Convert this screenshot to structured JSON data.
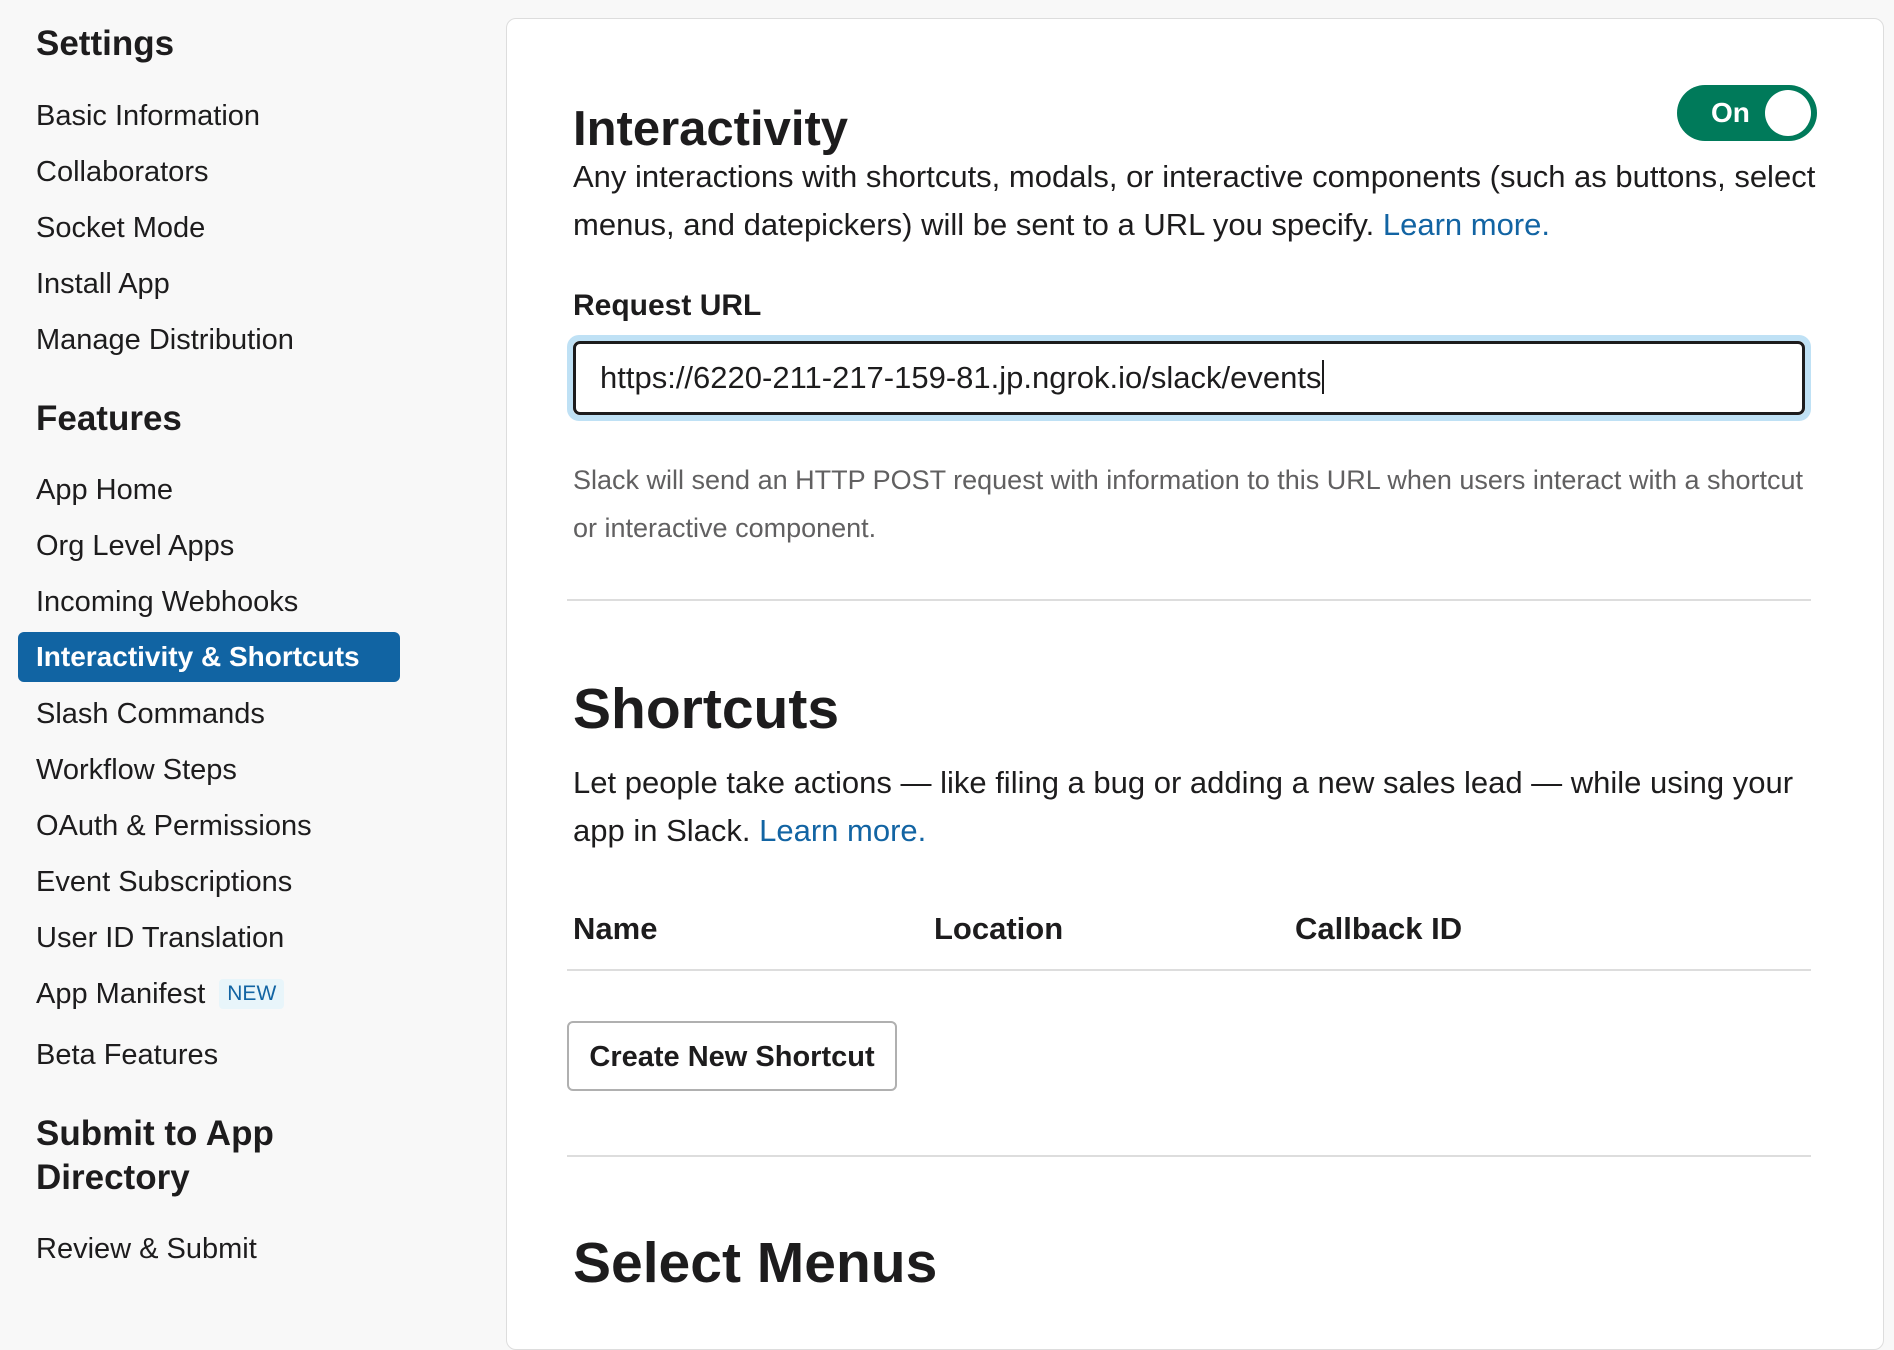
{
  "sidebar": {
    "settings_heading": "Settings",
    "settings_items": [
      {
        "label": "Basic Information"
      },
      {
        "label": "Collaborators"
      },
      {
        "label": "Socket Mode"
      },
      {
        "label": "Install App"
      },
      {
        "label": "Manage Distribution"
      }
    ],
    "features_heading": "Features",
    "features_items": [
      {
        "label": "App Home"
      },
      {
        "label": "Org Level Apps"
      },
      {
        "label": "Incoming Webhooks"
      },
      {
        "label": "Interactivity & Shortcuts",
        "active": true
      },
      {
        "label": "Slash Commands"
      },
      {
        "label": "Workflow Steps"
      },
      {
        "label": "OAuth & Permissions"
      },
      {
        "label": "Event Subscriptions"
      },
      {
        "label": "User ID Translation"
      },
      {
        "label": "App Manifest",
        "badge": "NEW"
      },
      {
        "label": "Beta Features"
      }
    ],
    "submit_heading_line1": "Submit to App",
    "submit_heading_line2": "Directory",
    "submit_items": [
      {
        "label": "Review & Submit"
      }
    ]
  },
  "interactivity": {
    "title": "Interactivity",
    "toggle_label": "On",
    "toggle_on": true,
    "description": "Any interactions with shortcuts, modals, or interactive components (such as buttons, select menus, and datepickers) will be sent to a URL you specify.",
    "learn_more": "Learn more.",
    "request_url_label": "Request URL",
    "request_url_value": "https://6220-211-217-159-81.jp.ngrok.io/slack/events",
    "hint": "Slack will send an HTTP POST request with information to this URL when users interact with a shortcut or interactive component."
  },
  "shortcuts": {
    "title": "Shortcuts",
    "description": "Let people take actions — like filing a bug or adding a new sales lead — while using your app in Slack.",
    "learn_more": "Learn more.",
    "columns": [
      "Name",
      "Location",
      "Callback ID"
    ],
    "create_button": "Create New Shortcut"
  },
  "select_menus": {
    "title": "Select Menus"
  },
  "colors": {
    "accent": "#1164a3",
    "link": "#1264a3",
    "toggle_on": "#007a5a",
    "focus_ring": "#bfe1f5"
  }
}
